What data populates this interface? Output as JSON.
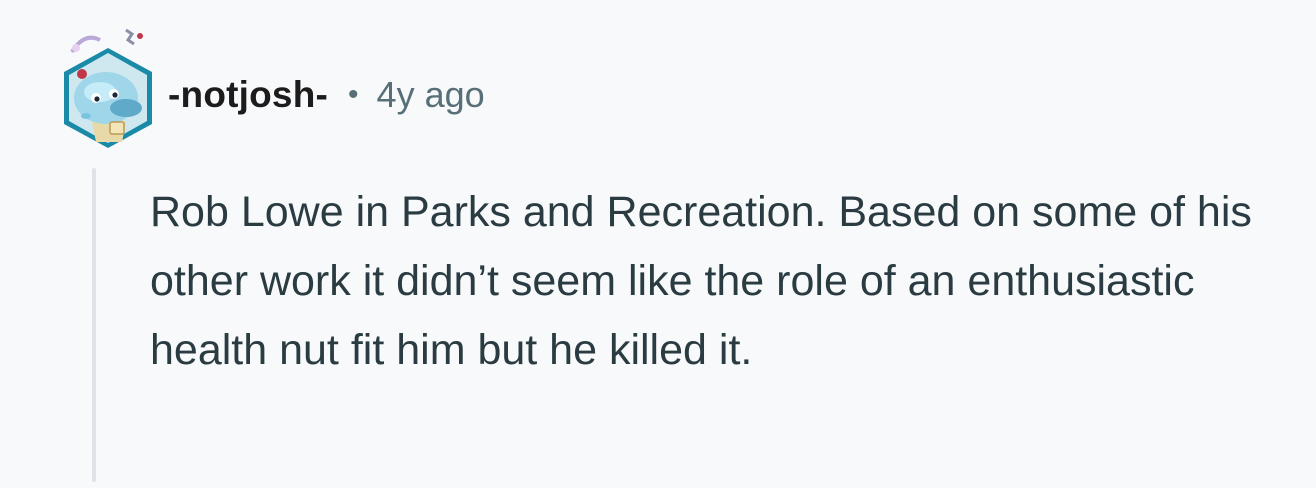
{
  "comment": {
    "author": "-notjosh-",
    "separator": "•",
    "timestamp": "4y ago",
    "body": "Rob Lowe in Parks and Recreation. Based on some of his other work it didn’t seem like the role of an enthusiastic health nut fit him but he killed it."
  },
  "avatar": {
    "icon": "snoo-avatar-icon",
    "frame_color": "#1a8aa6",
    "character_color": "#9fd6ea"
  },
  "colors": {
    "background": "#f8f9fb",
    "author": "#1c1c1c",
    "meta": "#576f76",
    "body": "#2a3c42",
    "thread_line": "#dfe3e8"
  }
}
